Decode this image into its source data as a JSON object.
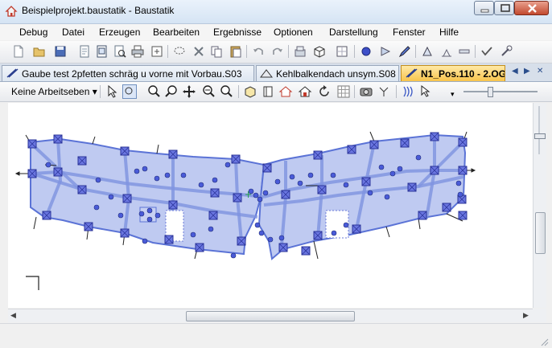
{
  "window": {
    "title": "Beispielprojekt.baustatik - Baustatik"
  },
  "menu": {
    "items": [
      "Debug",
      "Datei",
      "Erzeugen",
      "Bearbeiten",
      "Ergebnisse",
      "Optionen",
      "Darstellung",
      "Fenster",
      "Hilfe"
    ]
  },
  "tabs": [
    {
      "label": "Gaube test 2pfetten schräg u vorne mit Vorbau.S03",
      "active": false
    },
    {
      "label": "Kehlbalkendach unsym.S08",
      "active": false
    },
    {
      "label": "N1_Pos.110 - 2.OG.",
      "active": true
    }
  ],
  "toolbar2": {
    "workplane_label": "Keine Arbeitseben"
  },
  "colors": {
    "slab_fill": "#aab8ec",
    "slab_edge": "#5b73d6",
    "node": "#4a5bd8",
    "active_tab": "#f8c44c"
  }
}
